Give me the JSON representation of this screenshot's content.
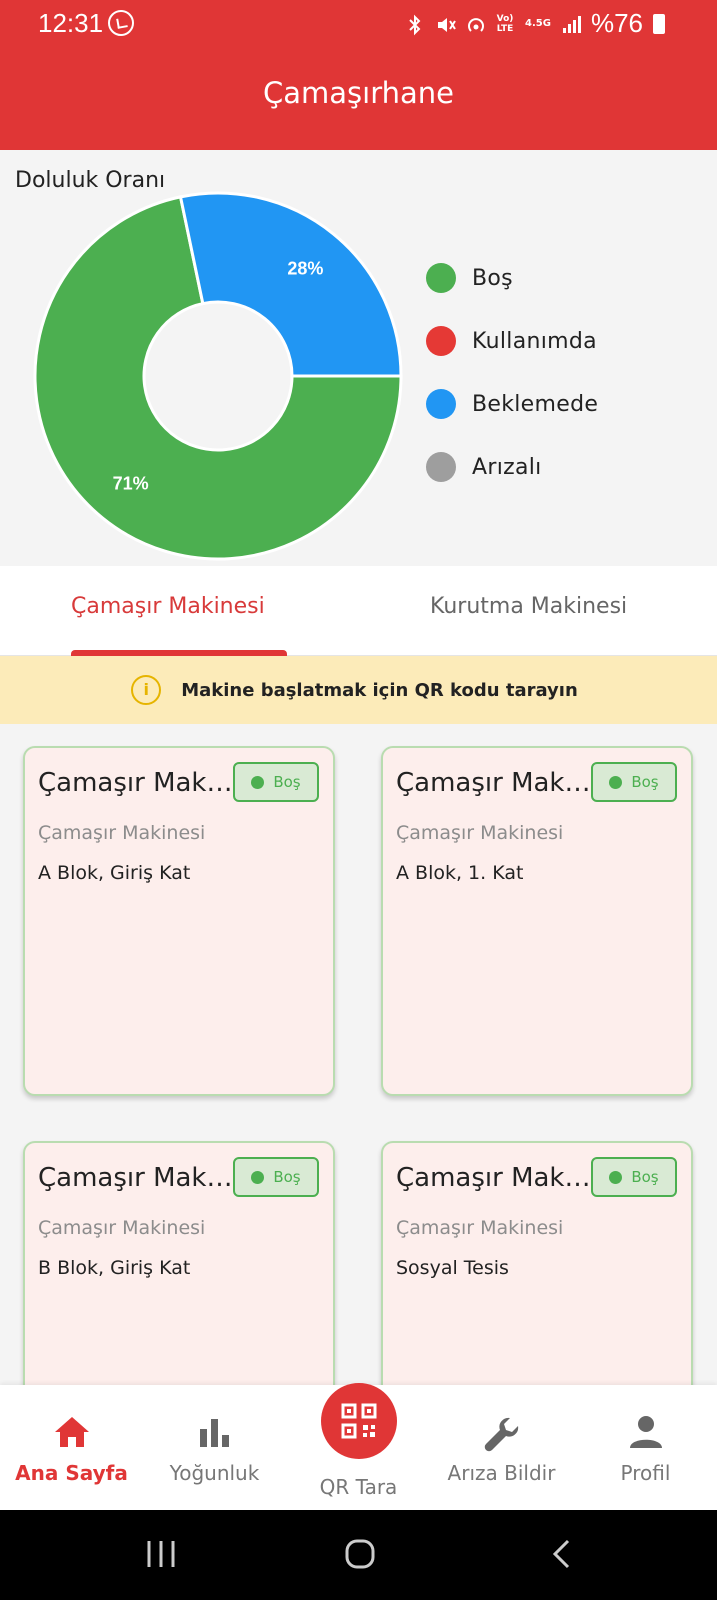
{
  "status": {
    "time": "12:31",
    "network": "4.5G",
    "battery": "%76",
    "icons": [
      "whatsapp-icon",
      "bluetooth-icon",
      "mute-icon",
      "hotspot-icon",
      "volte-icon",
      "signal-icon",
      "battery-icon"
    ]
  },
  "app": {
    "title": "Çamaşırhane"
  },
  "chart_section": {
    "title": "Doluluk Oranı"
  },
  "chart_data": {
    "type": "pie",
    "title": "Doluluk Oranı",
    "categories": [
      "Boş",
      "Kullanımda",
      "Beklemede",
      "Arızalı"
    ],
    "values": [
      71,
      0,
      28,
      0
    ],
    "data_labels": [
      "71%",
      "",
      "28%",
      ""
    ],
    "colors": [
      "#4caf50",
      "#e53935",
      "#2196f3",
      "#9e9e9e"
    ],
    "legend_placement": "right",
    "donut": true
  },
  "tabs": [
    "Çamaşır Makinesi",
    "Kurutma Makinesi"
  ],
  "active_tab": 0,
  "banner": {
    "text": "Makine başlatmak için QR kodu tarayın",
    "icon": "info-icon"
  },
  "machines": [
    {
      "name": "Çamaşır Makinesi",
      "status": "Boş",
      "type": "Çamaşır Makinesi",
      "location": "A Blok, Giriş Kat"
    },
    {
      "name": "Çamaşır Makinesi",
      "status": "Boş",
      "type": "Çamaşır Makinesi",
      "location": "A Blok, 1. Kat"
    },
    {
      "name": "Çamaşır Makinesi",
      "status": "Boş",
      "type": "Çamaşır Makinesi",
      "location": "B Blok, Giriş Kat"
    },
    {
      "name": "Çamaşır Makinesi",
      "status": "Boş",
      "type": "Çamaşır Makinesi",
      "location": "Sosyal Tesis"
    }
  ],
  "nav": [
    {
      "label": "Ana Sayfa",
      "icon": "home-icon",
      "active": true
    },
    {
      "label": "Yoğunluk",
      "icon": "bar-chart-icon",
      "active": false
    },
    {
      "label": "QR Tara",
      "icon": "qr-code-icon",
      "active": false
    },
    {
      "label": "Arıza Bildir",
      "icon": "wrench-icon",
      "active": false
    },
    {
      "label": "Profil",
      "icon": "person-icon",
      "active": false
    }
  ],
  "colors": {
    "primary": "#e03636",
    "success": "#4caf50",
    "info": "#2196f3",
    "muted": "#9e9e9e",
    "banner": "#fcebb9"
  }
}
